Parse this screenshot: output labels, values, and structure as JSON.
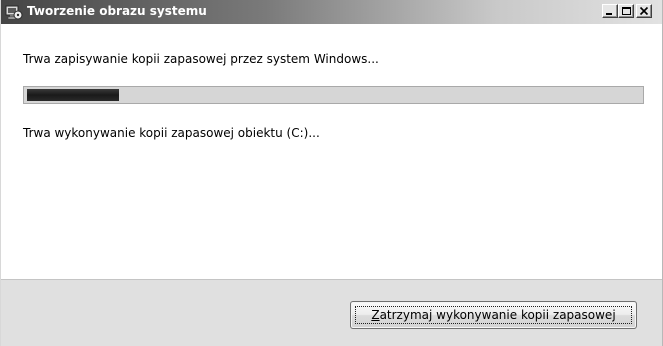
{
  "window": {
    "title": "Tworzenie obrazu systemu",
    "icon": "backup-disk-icon",
    "controls": [
      "minimize-icon",
      "maximize-icon",
      "close-icon"
    ]
  },
  "main": {
    "heading": "Trwa zapisywanie kopii zapasowej przez system Windows...",
    "progress": {
      "fraction": 0.15,
      "color": "#1a1a1a",
      "track_color": "#d6d6d6"
    },
    "status": "Trwa wykonywanie kopii zapasowej obiektu (C:)..."
  },
  "footer": {
    "stop_button": {
      "mnemonic": "Z",
      "rest": "atrzymaj wykonywanie kopii zapasowej"
    }
  }
}
